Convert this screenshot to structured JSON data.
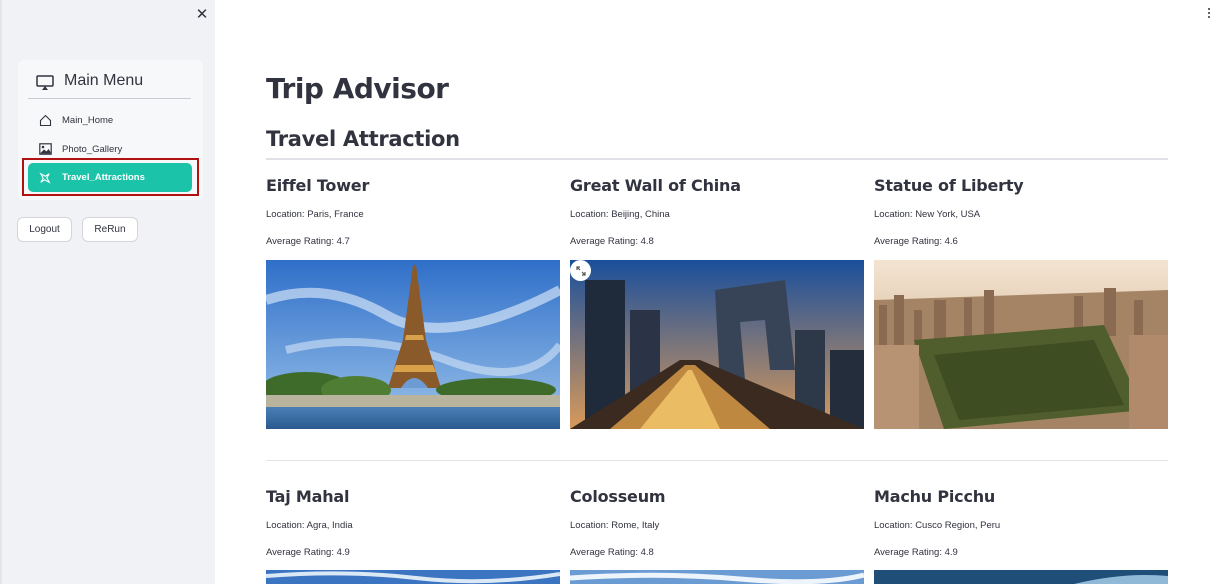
{
  "sidebar": {
    "menu_title": "Main Menu",
    "items": [
      {
        "label": "Main_Home",
        "icon": "house-icon"
      },
      {
        "label": "Photo_Gallery",
        "icon": "image-icon"
      },
      {
        "label": "Travel_Attractions",
        "icon": "airplane-icon",
        "active": true
      }
    ],
    "logout_label": "Logout",
    "rerun_label": "ReRun"
  },
  "main": {
    "title": "Trip Advisor",
    "section_title": "Travel Attraction",
    "attractions": [
      {
        "name": "Eiffel Tower",
        "location": "Location: Paris, France",
        "rating": "Average Rating: 4.7"
      },
      {
        "name": "Great Wall of China",
        "location": "Location: Beijing, China",
        "rating": "Average Rating: 4.8"
      },
      {
        "name": "Statue of Liberty",
        "location": "Location: New York, USA",
        "rating": "Average Rating: 4.6"
      },
      {
        "name": "Taj Mahal",
        "location": "Location: Agra, India",
        "rating": "Average Rating: 4.9"
      },
      {
        "name": "Colosseum",
        "location": "Location: Rome, Italy",
        "rating": "Average Rating: 4.8"
      },
      {
        "name": "Machu Picchu",
        "location": "Location: Cusco Region, Peru",
        "rating": "Average Rating: 4.9"
      }
    ]
  },
  "colors": {
    "accent": "#1bc4a8",
    "sidebar_bg": "#f0f2f6",
    "highlight_border": "#b01212",
    "text": "#31333f"
  }
}
